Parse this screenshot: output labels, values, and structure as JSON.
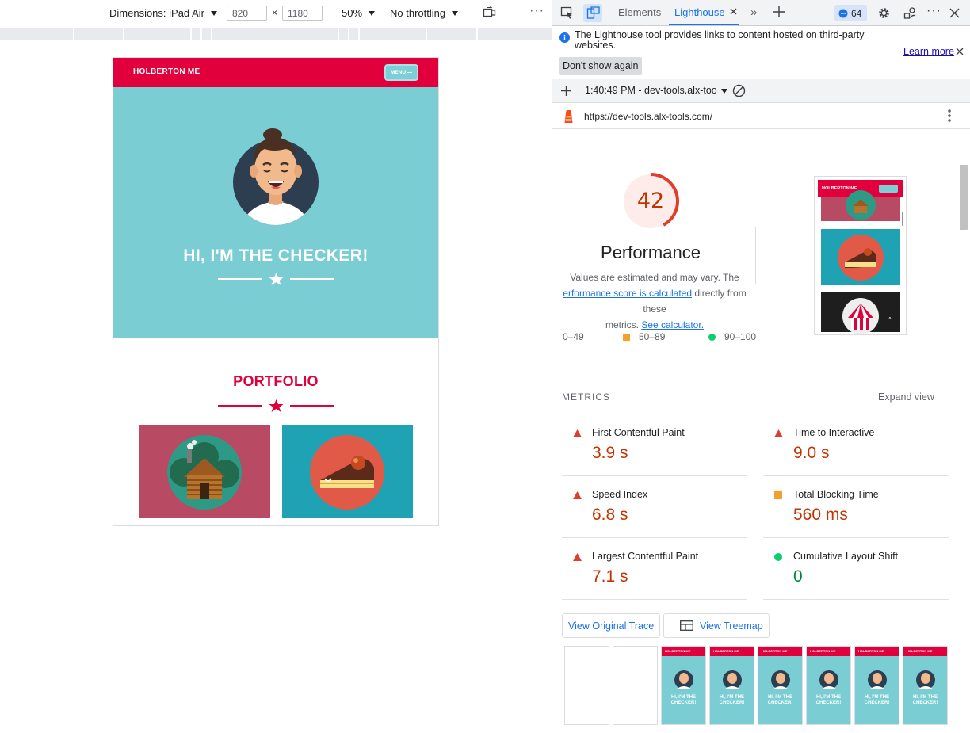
{
  "device_toolbar": {
    "dimensions_label": "Dimensions: iPad Air",
    "width": "820",
    "times": "×",
    "height": "1180",
    "zoom": "50%",
    "throttling": "No throttling",
    "more": "⋮"
  },
  "site": {
    "brand": "HOLBERTON ME",
    "menu_label": "MENU",
    "hero_title": "HI, I'M THE CHECKER!",
    "portfolio_title": "PORTFOLIO",
    "colors": {
      "primary": "#e1003c",
      "hero_bg": "#7acdd2",
      "tile1": "#b94a63",
      "tile2": "#20a2b5"
    }
  },
  "devtools": {
    "tabs": [
      {
        "label": "Elements"
      },
      {
        "label": "Lighthouse"
      }
    ],
    "issues_count": "64",
    "info_text": "The Lighthouse tool provides links to content hosted on third-party websites.",
    "learn_more": "Learn more",
    "dont_show": "Don't show again",
    "report_select": "1:40:49 PM - dev-tools.alx-too",
    "url": "https://dev-tools.alx-tools.com/"
  },
  "performance": {
    "score": "42",
    "score_fraction": 0.42,
    "title": "Performance",
    "desc_line1": "Values are estimated and may vary. The",
    "desc_link1": "erformance score is calculated",
    "desc_line2": " directly from these",
    "desc_line3": "metrics. ",
    "desc_link2": "See calculator.",
    "legend": [
      {
        "range": "0–49",
        "color": "#e03e2d"
      },
      {
        "range": "50–89",
        "color": "#f4a02d"
      },
      {
        "range": "90–100",
        "color": "#0cce6b"
      }
    ]
  },
  "metrics": {
    "heading": "METRICS",
    "expand": "Expand view",
    "items": [
      {
        "label": "First Contentful Paint",
        "value": "3.9 s",
        "status": "fail"
      },
      {
        "label": "Time to Interactive",
        "value": "9.0 s",
        "status": "fail"
      },
      {
        "label": "Speed Index",
        "value": "6.8 s",
        "status": "fail"
      },
      {
        "label": "Total Blocking Time",
        "value": "560 ms",
        "status": "average"
      },
      {
        "label": "Largest Contentful Paint",
        "value": "7.1 s",
        "status": "fail"
      },
      {
        "label": "Cumulative Layout Shift",
        "value": "0",
        "status": "pass"
      }
    ]
  },
  "buttons": {
    "view_trace": "View Original Trace",
    "view_treemap": "View Treemap"
  },
  "filmstrip": {
    "frame_brand": "HOLBERTON ME",
    "frame_title": "HI, I'M THE CHECKER!"
  }
}
